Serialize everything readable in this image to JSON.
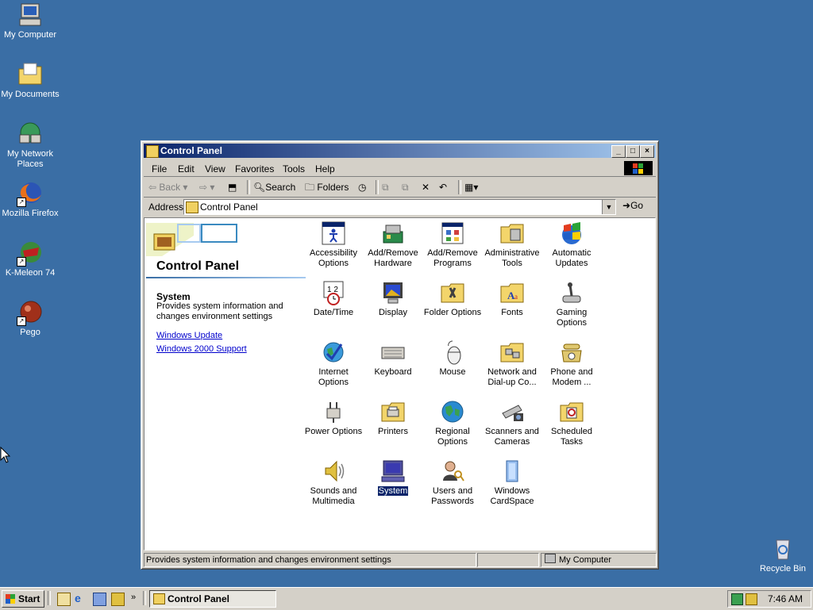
{
  "desktop": {
    "icons": [
      {
        "label": "My Computer",
        "icon": "my-computer-icon"
      },
      {
        "label": "My Documents",
        "icon": "my-documents-icon"
      },
      {
        "label": "My Network Places",
        "icon": "network-places-icon"
      },
      {
        "label": "Mozilla Firefox",
        "icon": "firefox-icon"
      },
      {
        "label": "K-Meleon 74",
        "icon": "k-meleon-icon"
      },
      {
        "label": "Pego",
        "icon": "pego-icon"
      },
      {
        "label": "Recycle Bin",
        "icon": "recycle-bin-icon"
      }
    ]
  },
  "window": {
    "title": "Control Panel",
    "menu": [
      "File",
      "Edit",
      "View",
      "Favorites",
      "Tools",
      "Help"
    ],
    "toolbar": {
      "back": "Back",
      "search": "Search",
      "folders": "Folders"
    },
    "address": {
      "label": "Address",
      "value": "Control Panel",
      "go": "Go"
    },
    "left_pane": {
      "title": "Control Panel",
      "selected_name": "System",
      "selected_desc": "Provides system information and changes environment settings",
      "links": [
        "Windows Update",
        "Windows 2000 Support"
      ]
    },
    "items": [
      {
        "label": "Accessibility Options",
        "icon": "accessibility-icon"
      },
      {
        "label": "Add/Remove Hardware",
        "icon": "add-hardware-icon"
      },
      {
        "label": "Add/Remove Programs",
        "icon": "add-programs-icon"
      },
      {
        "label": "Administrative Tools",
        "icon": "admin-tools-icon"
      },
      {
        "label": "Automatic Updates",
        "icon": "auto-updates-icon"
      },
      {
        "label": "Date/Time",
        "icon": "date-time-icon"
      },
      {
        "label": "Display",
        "icon": "display-icon"
      },
      {
        "label": "Folder Options",
        "icon": "folder-options-icon"
      },
      {
        "label": "Fonts",
        "icon": "fonts-icon"
      },
      {
        "label": "Gaming Options",
        "icon": "gaming-icon"
      },
      {
        "label": "Internet Options",
        "icon": "internet-options-icon"
      },
      {
        "label": "Keyboard",
        "icon": "keyboard-icon"
      },
      {
        "label": "Mouse",
        "icon": "mouse-icon"
      },
      {
        "label": "Network and Dial-up Co...",
        "icon": "network-dialup-icon"
      },
      {
        "label": "Phone and Modem ...",
        "icon": "phone-modem-icon"
      },
      {
        "label": "Power Options",
        "icon": "power-options-icon"
      },
      {
        "label": "Printers",
        "icon": "printers-icon"
      },
      {
        "label": "Regional Options",
        "icon": "regional-icon"
      },
      {
        "label": "Scanners and Cameras",
        "icon": "scanners-icon"
      },
      {
        "label": "Scheduled Tasks",
        "icon": "scheduled-tasks-icon"
      },
      {
        "label": "Sounds and Multimedia",
        "icon": "sounds-icon"
      },
      {
        "label": "System",
        "icon": "system-icon",
        "selected": true
      },
      {
        "label": "Users and Passwords",
        "icon": "users-icon"
      },
      {
        "label": "Windows CardSpace",
        "icon": "cardspace-icon"
      }
    ],
    "status": {
      "text": "Provides system information and changes environment settings",
      "zone": "My Computer"
    }
  },
  "taskbar": {
    "start": "Start",
    "task": "Control Panel",
    "clock": "7:46 AM"
  }
}
